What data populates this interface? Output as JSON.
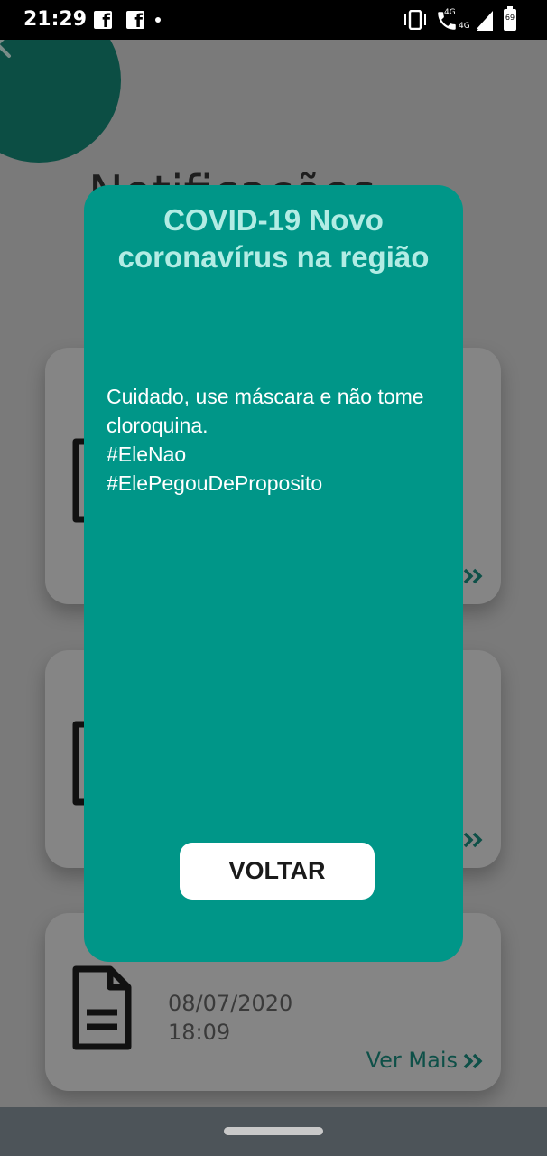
{
  "status_bar": {
    "time": "21:29",
    "net_left": "4G",
    "net_right": "4G",
    "battery": "69",
    "icons": [
      "facebook-icon",
      "facebook-icon",
      "notification-dot-icon",
      "vibrate-icon",
      "wifi-call-icon",
      "signal-icon",
      "signal-icon",
      "battery-icon"
    ]
  },
  "header": {
    "title": "Notificações",
    "back_icon": "chevron-left-icon"
  },
  "cards": [
    {
      "title": "",
      "date": "",
      "time": "",
      "action": ""
    },
    {
      "title": "",
      "date": "",
      "time": "",
      "action": ""
    },
    {
      "title": "",
      "date": "08/07/2020",
      "time": "18:09",
      "action": "Ver Mais"
    }
  ],
  "modal": {
    "title": "COVID-19 Novo coronavírus na região",
    "body_lines": [
      "Cuidado, use máscara e não tome cloroquina.",
      "#EleNao",
      "#ElePegouDeProposito"
    ],
    "button_label": "VOLTAR"
  },
  "colors": {
    "modal_bg": "#009688",
    "modal_title": "#b2ece4",
    "back_circle": "#0c4e44",
    "overlay_bg": "#7a7a7a",
    "nav_bar": "#4d5459"
  }
}
